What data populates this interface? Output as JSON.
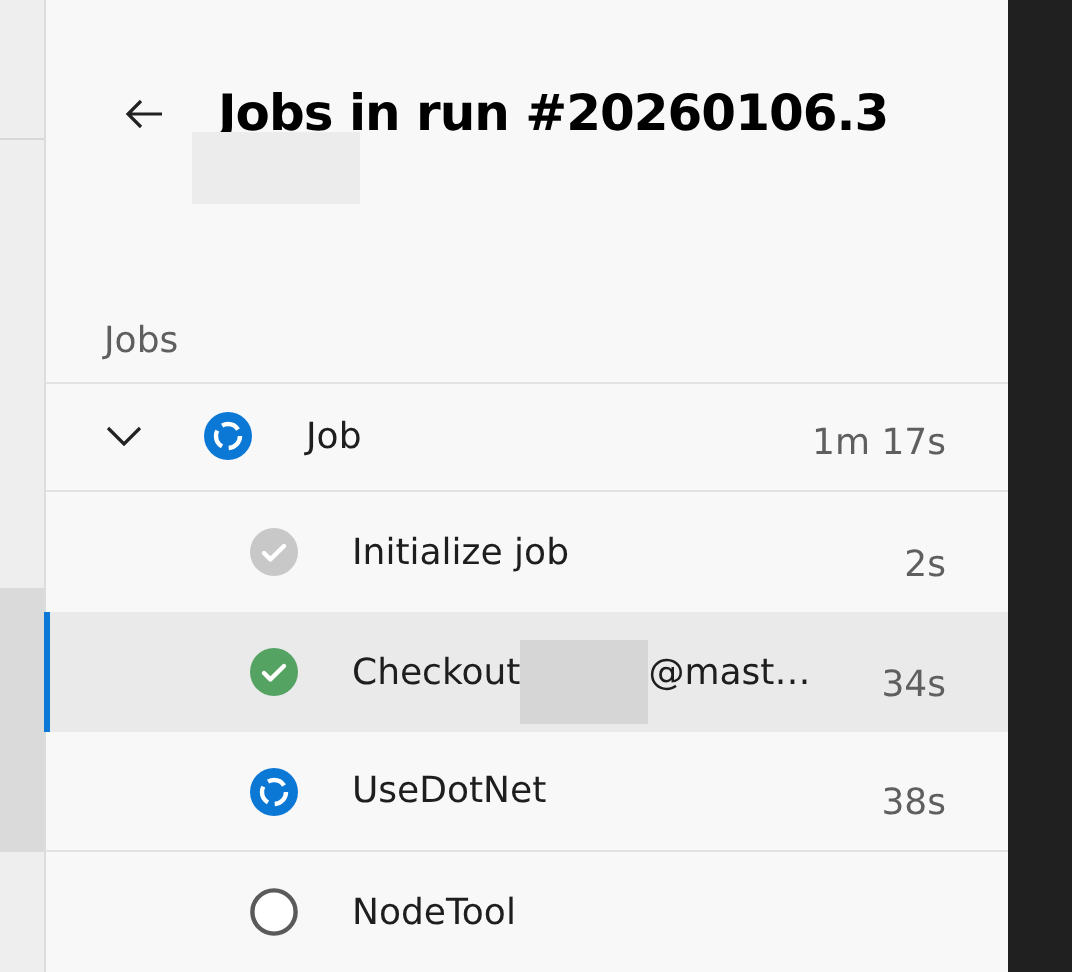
{
  "panel": {
    "title": "Jobs in run #20260106.3",
    "section_label": "Jobs"
  },
  "job": {
    "name": "Job",
    "duration": "1m 17s",
    "kind": "running",
    "expanded": true,
    "steps": [
      {
        "name_start": "Initialize job",
        "duration": "2s",
        "kind": "done",
        "selected": false,
        "redacted": false
      },
      {
        "name_start": "Checkout",
        "name_end": "@mast…",
        "duration": "34s",
        "kind": "succeeded",
        "selected": true,
        "redacted": true
      },
      {
        "name_start": "UseDotNet",
        "duration": "38s",
        "kind": "running",
        "selected": false,
        "redacted": false
      },
      {
        "name_start": "NodeTool",
        "kind": "pending",
        "selected": false,
        "redacted": false
      }
    ]
  }
}
